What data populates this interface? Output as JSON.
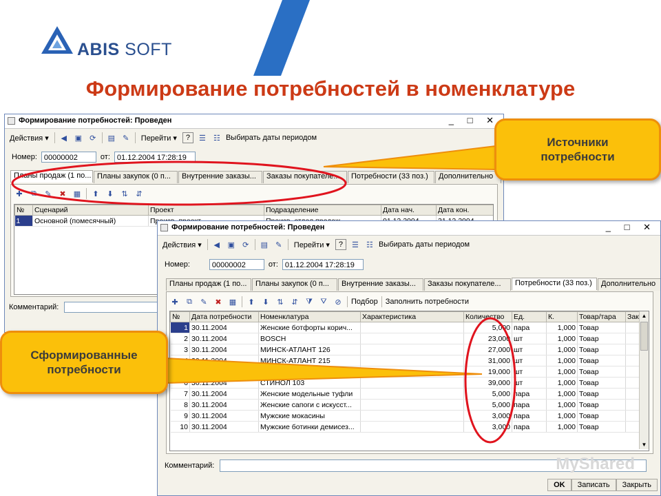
{
  "brand": {
    "name_bold": "ABIS",
    "name_rest": " SOFT"
  },
  "slide": {
    "title": "Формирование потребностей в номенклатуре"
  },
  "colors": {
    "title": "#cc3a16",
    "callout_fill": "#fbc00a",
    "callout_border": "#ee8e0c",
    "highlight_ellipse": "#e0141e",
    "selected_row": "#2b3e8c"
  },
  "back_window": {
    "title": "Формирование потребностей: Проведен",
    "title_buttons": "_ □ ✕",
    "toolbar": {
      "actions": "Действия ▾",
      "goto": "Перейти ▾",
      "help": "?",
      "choose_dates": "Выбирать даты периодом"
    },
    "number_label": "Номер:",
    "number_value": "00000002",
    "from_label": "от:",
    "date_value": "01.12.2004 17:28:19",
    "tabs": [
      "Планы продаж (1 по...",
      "Планы закупок (0 п...",
      "Внутренние заказы...",
      "Заказы покупателе...",
      "Потребности (33 поз.)",
      "Дополнительно"
    ],
    "columns": [
      "№",
      "Сценарий",
      "Проект",
      "Подразделение",
      "Дата нач.",
      "Дата кон."
    ],
    "rows": [
      [
        "1",
        "Основной (помесячный)",
        "Произв. проект",
        "Произв. отдел продаж",
        "01.12.2004",
        "31.12.2004"
      ]
    ],
    "comment_label": "Комментарий:"
  },
  "front_window": {
    "title": "Формирование потребностей: Проведен",
    "title_buttons": "_ □ ✕",
    "toolbar": {
      "actions": "Действия ▾",
      "goto": "Перейти ▾",
      "help": "?",
      "choose_dates": "Выбирать даты периодом"
    },
    "number_label": "Номер:",
    "number_value": "00000002",
    "from_label": "от:",
    "date_value": "01.12.2004 17:28:19",
    "tabs": [
      "Планы продаж (1 по...",
      "Планы закупок (0 п...",
      "Внутренние заказы...",
      "Заказы покупателе...",
      "Потребности (33 поз.)",
      "Дополнительно"
    ],
    "active_tab": 4,
    "subtoolbar": {
      "select": "Подбор",
      "fill": "Заполнить потребности"
    },
    "columns": [
      "№",
      "Дата потребности",
      "Номенклатура",
      "Характеристика",
      "Количество",
      "Ед.",
      "К.",
      "Товар/тара",
      "Зак"
    ],
    "rows": [
      [
        "1",
        "30.11.2004",
        "Женские ботфорты корич...",
        "",
        "5,000",
        "пара",
        "1,000",
        "Товар"
      ],
      [
        "2",
        "30.11.2004",
        "BOSCH",
        "",
        "23,000",
        "шт",
        "1,000",
        "Товар"
      ],
      [
        "3",
        "30.11.2004",
        "МИНСК-АТЛАНТ 126",
        "",
        "27,000",
        "шт",
        "1,000",
        "Товар"
      ],
      [
        "4",
        "30.11.2004",
        "МИНСК-АТЛАНТ 215",
        "",
        "31,000",
        "шт",
        "1,000",
        "Товар"
      ],
      [
        "5",
        "30.11.2004",
        "СТИНОЛ 102",
        "",
        "19,000",
        "шт",
        "1,000",
        "Товар"
      ],
      [
        "6",
        "30.11.2004",
        "СТИНОЛ 103",
        "",
        "39,000",
        "шт",
        "1,000",
        "Товар"
      ],
      [
        "7",
        "30.11.2004",
        "Женские модельные туфли",
        "",
        "5,000",
        "пара",
        "1,000",
        "Товар"
      ],
      [
        "8",
        "30.11.2004",
        "Женские сапоги с искусст...",
        "",
        "5,000",
        "пара",
        "1,000",
        "Товар"
      ],
      [
        "9",
        "30.11.2004",
        "Мужские мокасины",
        "",
        "3,000",
        "пара",
        "1,000",
        "Товар"
      ],
      [
        "10",
        "30.11.2004",
        "Мужские ботинки демисез...",
        "",
        "3,000",
        "пара",
        "1,000",
        "Товар"
      ]
    ],
    "comment_label": "Комментарий:",
    "buttons": {
      "ok": "OK",
      "save": "Записать",
      "close": "Закрыть"
    }
  },
  "callouts": {
    "sources": "Источники потребности",
    "formed": "Сформированные потребности"
  },
  "watermark": "MyShared"
}
